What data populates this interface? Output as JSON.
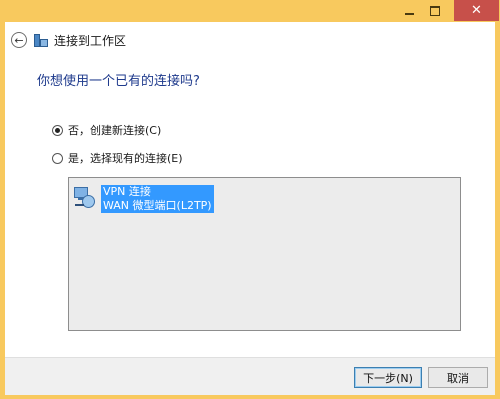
{
  "window": {
    "title": "连接到工作区",
    "close_glyph": "✕",
    "back_glyph": "←"
  },
  "main": {
    "question": "你想使用一个已有的连接吗?",
    "options": [
      {
        "label": "否，创建新连接(C)",
        "selected": true
      },
      {
        "label": "是，选择现有的连接(E)",
        "selected": false
      }
    ],
    "connections": [
      {
        "name": "VPN 连接",
        "detail": "WAN 微型端口(L2TP)",
        "icon": "network-connection-icon",
        "selected": true
      }
    ]
  },
  "footer": {
    "next_label": "下一步(N)",
    "cancel_label": "取消"
  },
  "colors": {
    "title_bar": "#f8c95e",
    "close_button": "#c7504a",
    "selection": "#3399ff",
    "heading": "#1e3a8c"
  }
}
